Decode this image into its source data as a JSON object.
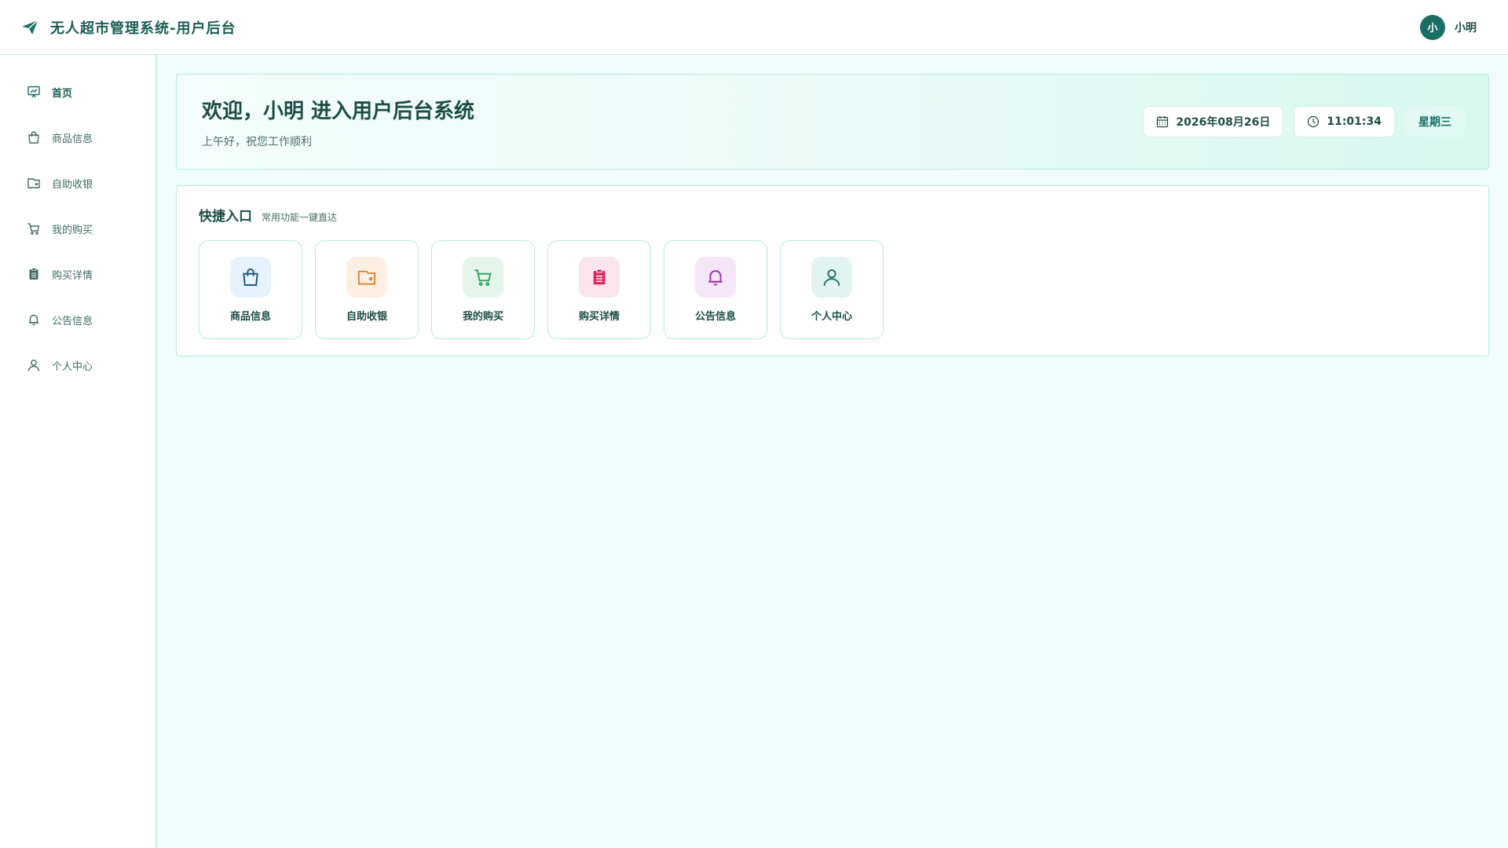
{
  "header": {
    "title": "无人超市管理系统-用户后台",
    "brand_icon": "paper-plane-icon",
    "user": {
      "avatar_text": "小",
      "name": "小明"
    }
  },
  "sidebar": {
    "items": [
      {
        "label": "首页",
        "icon": "presentation-chart-icon",
        "active": true
      },
      {
        "label": "商品信息",
        "icon": "shopping-bag-icon"
      },
      {
        "label": "自助收银",
        "icon": "wallet-icon"
      },
      {
        "label": "我的购买",
        "icon": "cart-icon"
      },
      {
        "label": "购买详情",
        "icon": "clipboard-icon"
      },
      {
        "label": "公告信息",
        "icon": "bell-icon"
      },
      {
        "label": "个人中心",
        "icon": "user-icon"
      }
    ]
  },
  "welcome": {
    "title": "欢迎，小明 进入用户后台系统",
    "subtitle": "上午好，祝您工作顺利",
    "date": "2026年08月26日",
    "time": "11:01:34",
    "weekday": "星期三"
  },
  "quick": {
    "title": "快捷入口",
    "subtitle": "常用功能一键直达",
    "tiles": [
      {
        "label": "商品信息",
        "icon": "shopping-bag-icon",
        "bg": "#e6f3fc",
        "fg": "#1d4f7a"
      },
      {
        "label": "自助收银",
        "icon": "wallet-icon",
        "bg": "#fdf0e2",
        "fg": "#e0822a"
      },
      {
        "label": "我的购买",
        "icon": "cart-icon",
        "bg": "#e4f6ec",
        "fg": "#2e9e5b"
      },
      {
        "label": "购买详情",
        "icon": "clipboard-icon",
        "bg": "#fce4ec",
        "fg": "#e0245e"
      },
      {
        "label": "公告信息",
        "icon": "bell-icon",
        "bg": "#f5e6f7",
        "fg": "#9c2fa8"
      },
      {
        "label": "个人中心",
        "icon": "user-icon",
        "bg": "#e2f4f1",
        "fg": "#1a6e64"
      }
    ]
  },
  "colors": {
    "brand": "#1a6e64",
    "page_bg": "#f0fcf9",
    "border": "#b8ebde"
  }
}
